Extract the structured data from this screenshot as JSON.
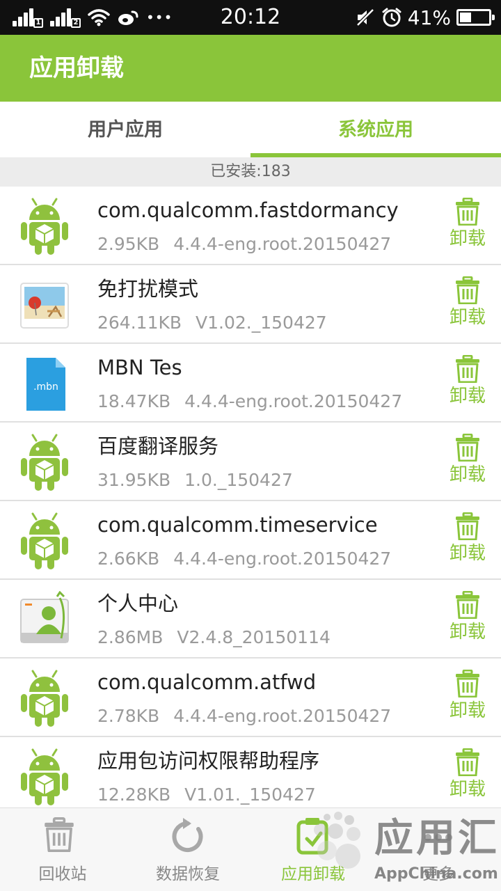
{
  "status_bar": {
    "sim1_label": "1",
    "sim2_label": "2",
    "more_label": "•••",
    "time": "20:12",
    "battery_text": "41%",
    "battery_level": 0.41
  },
  "header": {
    "title": "应用卸载"
  },
  "tabs": [
    {
      "label": "用户应用",
      "selected": false
    },
    {
      "label": "系统应用",
      "selected": true
    }
  ],
  "installed_text": "已安装:183",
  "uninstall_label": "卸载",
  "apps": [
    {
      "icon": "android-robot-icon",
      "name": "com.qualcomm.fastdormancy",
      "size": "2.95KB",
      "version": "4.4.4-eng.root.20150427"
    },
    {
      "icon": "beach-photo-icon",
      "name": "免打扰模式",
      "size": "264.11KB",
      "version": "V1.02._150427"
    },
    {
      "icon": "mbn-file-icon",
      "icon_text": ".mbn",
      "name": "MBN Tes",
      "size": "18.47KB",
      "version": "4.4.4-eng.root.20150427"
    },
    {
      "icon": "android-robot-icon",
      "name": "百度翻译服务",
      "size": "31.95KB",
      "version": "1.0._150427"
    },
    {
      "icon": "android-robot-icon",
      "name": "com.qualcomm.timeservice",
      "size": "2.66KB",
      "version": "4.4.4-eng.root.20150427"
    },
    {
      "icon": "contact-card-icon",
      "name": "个人中心",
      "size": "2.86MB",
      "version": "V2.4.8_20150114"
    },
    {
      "icon": "android-robot-icon",
      "name": "com.qualcomm.atfwd",
      "size": "2.78KB",
      "version": "4.4.4-eng.root.20150427"
    },
    {
      "icon": "android-robot-icon",
      "name": "应用包访问权限帮助程序",
      "size": "12.28KB",
      "version": "V1.01._150427"
    }
  ],
  "bottom_nav": [
    {
      "label": "回收站",
      "icon": "trash-icon",
      "active": false
    },
    {
      "label": "数据恢复",
      "icon": "refresh-icon",
      "active": false
    },
    {
      "label": "应用卸载",
      "icon": "uninstall-icon",
      "active": true
    },
    {
      "label": "更多",
      "icon": "more-icon",
      "active": false
    }
  ],
  "watermark": {
    "logo": "应用汇",
    "sub": "AppChina.com"
  },
  "colors": {
    "accent": "#8ac53a",
    "status_bar": "#101010",
    "android_green": "#8fc13e"
  }
}
